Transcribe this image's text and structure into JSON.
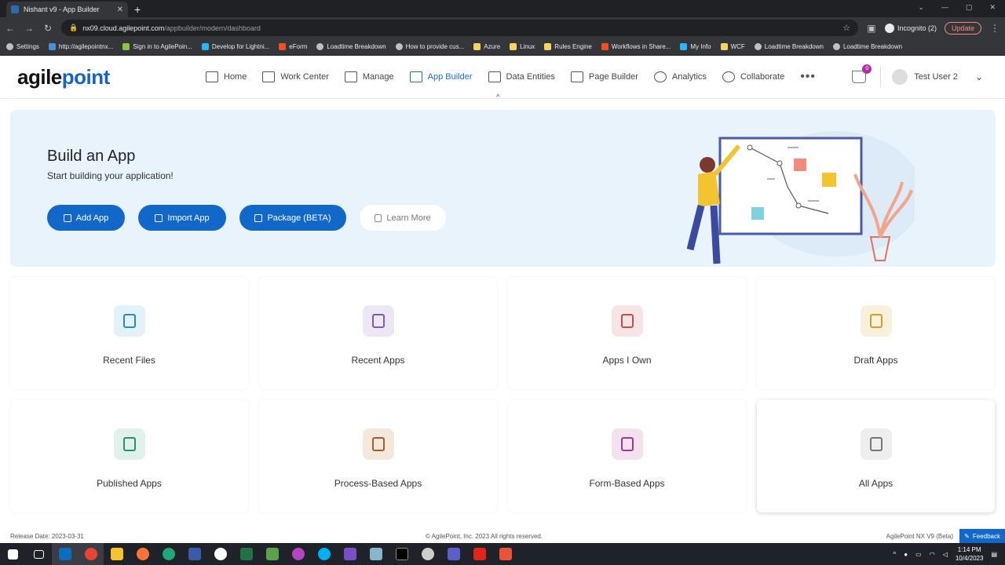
{
  "browser": {
    "tab_title": "Nishant v9 - App Builder",
    "tab_close": "✕",
    "new_tab": "+",
    "url_host": "nx09.cloud.agilepoint.com",
    "url_path": "/appbuilder/modern/dashboard",
    "incognito_label": "Incognito (2)",
    "update_label": "Update",
    "bookmarks": [
      "Settings",
      "http://agilepointnx...",
      "Sign in to AgilePoin...",
      "Develop for Lightni...",
      "eForm",
      "Loadtime Breakdown",
      "How to provide cus...",
      "Azure",
      "Linux",
      "Rules Engine",
      "Workflows in Share...",
      "My Info",
      "WCF",
      "Loadtime Breakdown",
      "Loadtime Breakdown"
    ]
  },
  "header": {
    "logo_prefix": "agile",
    "logo_suffix": "point",
    "nav": [
      "Home",
      "Work Center",
      "Manage",
      "App Builder",
      "Data Entities",
      "Page Builder",
      "Analytics",
      "Collaborate"
    ],
    "more": "•••",
    "cart_count": "0",
    "user_name": "Test User 2",
    "user_chevron": "⌄",
    "collapse_icon": "^"
  },
  "hero": {
    "title": "Build an App",
    "subtitle": "Start building your application!",
    "buttons": {
      "add": "Add App",
      "import": "Import App",
      "package": "Package (BETA)",
      "learn": "Learn More"
    }
  },
  "cards": [
    {
      "label": "Recent Files",
      "color": "#2a8bbd",
      "bg": "#e3f1f8"
    },
    {
      "label": "Recent Apps",
      "color": "#7b5bb5",
      "bg": "#ece6f5"
    },
    {
      "label": "Apps I Own",
      "color": "#c0504d",
      "bg": "#f7e4e4"
    },
    {
      "label": "Draft Apps",
      "color": "#c9a227",
      "bg": "#f7f0dc"
    },
    {
      "label": "Published Apps",
      "color": "#2e8b74",
      "bg": "#e0f1ec"
    },
    {
      "label": "Process-Based Apps",
      "color": "#a0602a",
      "bg": "#f4e8dc"
    },
    {
      "label": "Form-Based Apps",
      "color": "#a03a8a",
      "bg": "#f3e1ee"
    },
    {
      "label": "All Apps",
      "color": "#777777",
      "bg": "#eeeeee"
    }
  ],
  "footer": {
    "release": "Release Date: 2023-03-31",
    "copyright": "© AgilePoint, Inc. 2023 All rights reserved.",
    "version": "AgilePoint NX V9 (Beta)",
    "feedback": "Feedback"
  },
  "taskbar": {
    "time": "1:14 PM",
    "date": "10/4/2023"
  }
}
